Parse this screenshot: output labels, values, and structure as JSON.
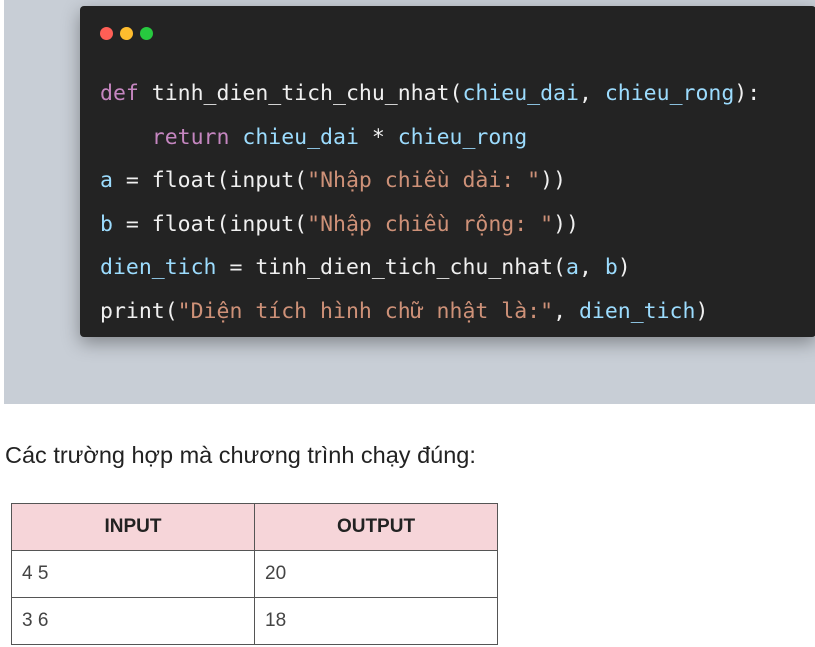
{
  "code_window": {
    "dot_colors": [
      "#ff5f56",
      "#ffbd2e",
      "#27c93f"
    ],
    "lines": [
      [
        {
          "t": "def ",
          "c": "kw"
        },
        {
          "t": "tinh_dien_tich_chu_nhat(",
          "c": "fn"
        },
        {
          "t": "chieu_dai",
          "c": "var"
        },
        {
          "t": ", ",
          "c": "plain"
        },
        {
          "t": "chieu_rong",
          "c": "var"
        },
        {
          "t": "):",
          "c": "plain"
        }
      ],
      [
        {
          "t": "    return ",
          "c": "kw"
        },
        {
          "t": "chieu_dai",
          "c": "var"
        },
        {
          "t": " * ",
          "c": "plain"
        },
        {
          "t": "chieu_rong",
          "c": "var"
        }
      ],
      [
        {
          "t": "a",
          "c": "var"
        },
        {
          "t": " = float(input(",
          "c": "plain"
        },
        {
          "t": "\"Nhập chiều dài: \"",
          "c": "str"
        },
        {
          "t": "))",
          "c": "plain"
        }
      ],
      [
        {
          "t": "b",
          "c": "var"
        },
        {
          "t": " = float(input(",
          "c": "plain"
        },
        {
          "t": "\"Nhập chiều rộng: \"",
          "c": "str"
        },
        {
          "t": "))",
          "c": "plain"
        }
      ],
      [
        {
          "t": "dien_tich",
          "c": "var"
        },
        {
          "t": " = tinh_dien_tich_chu_nhat(",
          "c": "plain"
        },
        {
          "t": "a",
          "c": "var"
        },
        {
          "t": ", ",
          "c": "plain"
        },
        {
          "t": "b",
          "c": "var"
        },
        {
          "t": ")",
          "c": "plain"
        }
      ],
      [
        {
          "t": "print(",
          "c": "plain"
        },
        {
          "t": "\"Diện tích hình chữ nhật là:\"",
          "c": "str"
        },
        {
          "t": ", ",
          "c": "plain"
        },
        {
          "t": "dien_tich",
          "c": "var"
        },
        {
          "t": ")",
          "c": "plain"
        }
      ]
    ]
  },
  "caption": "Các trường hợp mà chương trình chạy đúng:",
  "table": {
    "headers": [
      "INPUT",
      "OUTPUT"
    ],
    "rows": [
      [
        "4 5",
        "20"
      ],
      [
        "3 6",
        "18"
      ]
    ]
  }
}
